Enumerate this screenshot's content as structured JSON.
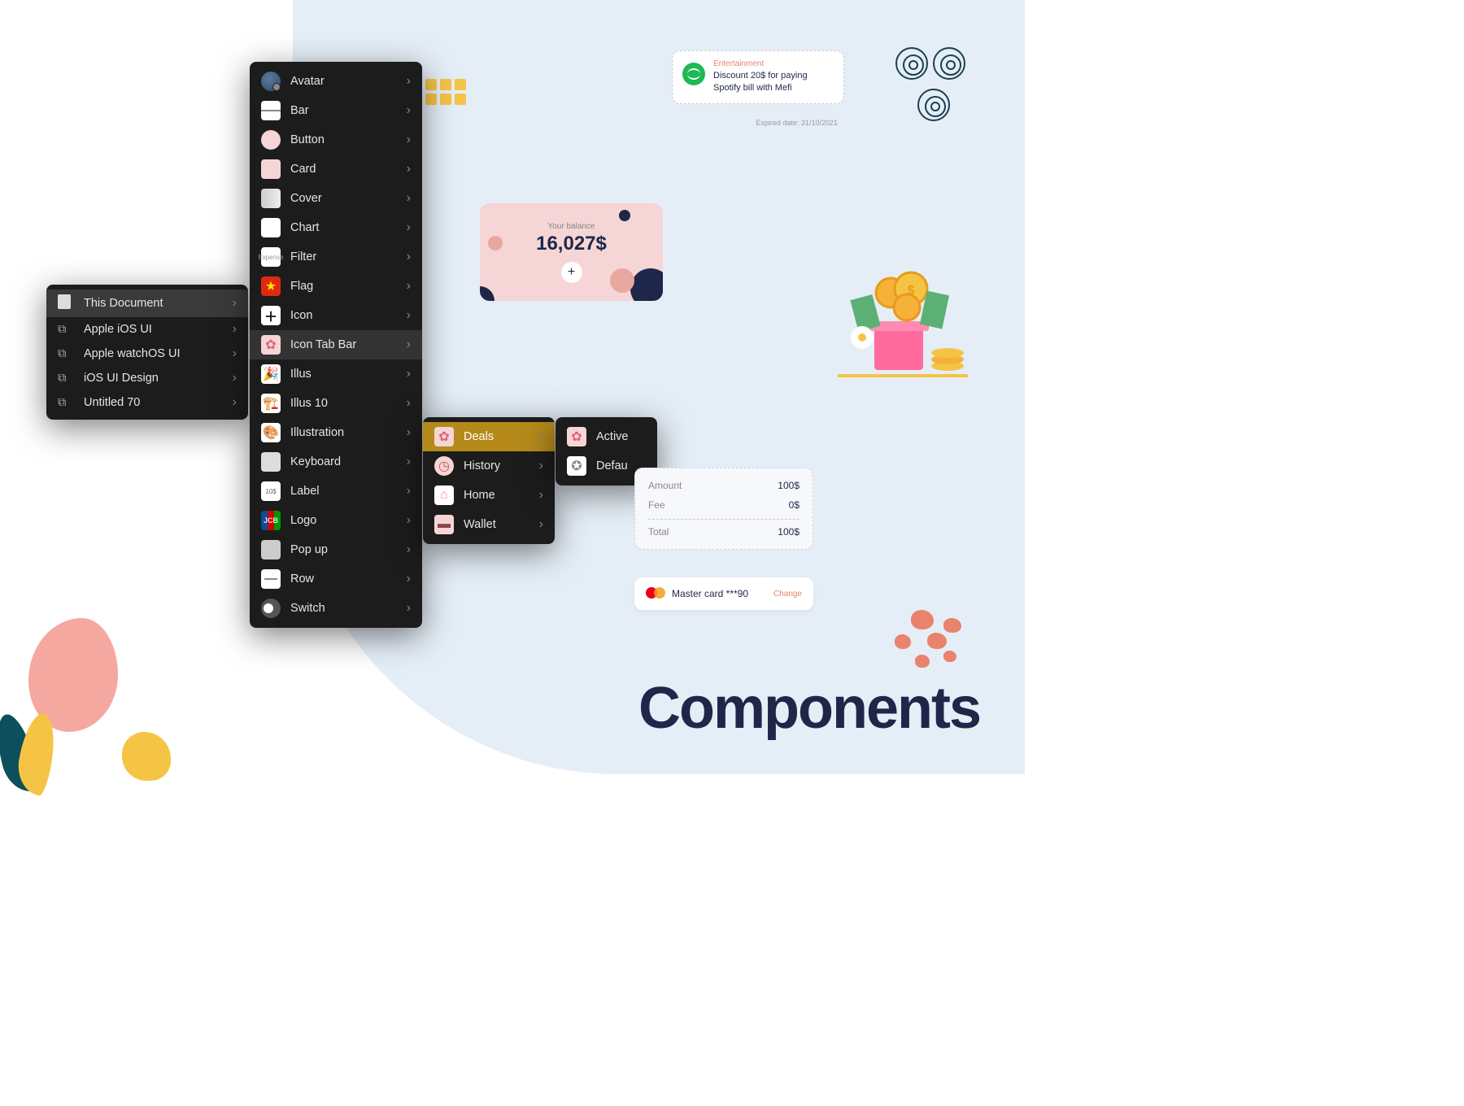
{
  "docs_menu": [
    {
      "label": "This Document",
      "icon": "doc",
      "selected": true
    },
    {
      "label": "Apple iOS UI",
      "icon": "link"
    },
    {
      "label": "Apple watchOS UI",
      "icon": "link"
    },
    {
      "label": "iOS UI Design",
      "icon": "link"
    },
    {
      "label": "Untitled 70",
      "icon": "link"
    }
  ],
  "main_menu": [
    {
      "label": "Avatar"
    },
    {
      "label": "Bar"
    },
    {
      "label": "Button"
    },
    {
      "label": "Card"
    },
    {
      "label": "Cover"
    },
    {
      "label": "Chart"
    },
    {
      "label": "Filter"
    },
    {
      "label": "Flag"
    },
    {
      "label": "Icon"
    },
    {
      "label": "Icon Tab Bar",
      "active": true
    },
    {
      "label": "Illus"
    },
    {
      "label": "Illus 10"
    },
    {
      "label": "Illustration"
    },
    {
      "label": "Keyboard"
    },
    {
      "label": "Label"
    },
    {
      "label": "Logo"
    },
    {
      "label": "Pop up"
    },
    {
      "label": "Row"
    },
    {
      "label": "Switch"
    }
  ],
  "sub_menu_1": [
    {
      "label": "Deals",
      "highlighted": true
    },
    {
      "label": "History"
    },
    {
      "label": "Home"
    },
    {
      "label": "Wallet"
    }
  ],
  "sub_menu_2": [
    {
      "label": "Active"
    },
    {
      "label": "Defau"
    }
  ],
  "notification": {
    "category": "Entertainment",
    "text": "Discount 20$ for paying Spotify bill with Mefi",
    "expired": "Expired date: 31/10/2021"
  },
  "balance": {
    "label": "Your balance",
    "amount": "16,027$"
  },
  "fee_card": {
    "amount_label": "Amount",
    "amount_value": "100$",
    "fee_label": "Fee",
    "fee_value": "0$",
    "total_label": "Total",
    "total_value": "100$"
  },
  "payment_card": {
    "name": "Master card ***90",
    "change": "Change"
  },
  "title": "Components"
}
